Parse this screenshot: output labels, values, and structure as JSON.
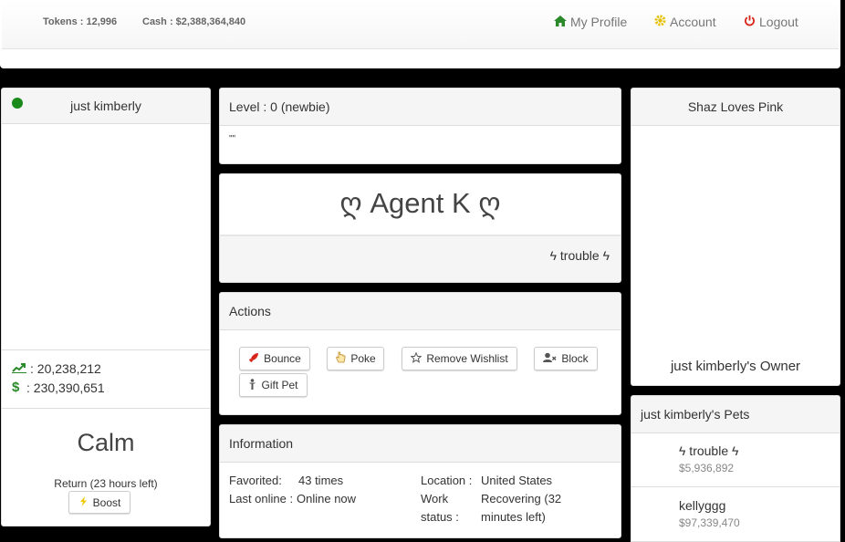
{
  "topbar": {
    "tokens": "Tokens : 12,996",
    "cash": "Cash : $2,388,364,840",
    "nav": {
      "profile": "My Profile",
      "account": "Account",
      "logout": "Logout"
    }
  },
  "left": {
    "name": "just kimberly",
    "stats": {
      "value_line": ": 20,238,212",
      "cash_line": ": 230,390,651"
    },
    "mood": "Calm",
    "return_text": "Return (23 hours left)",
    "boost_label": "Boost"
  },
  "center": {
    "level": "Level : 0 (newbie)",
    "quote": "\"\"",
    "title": "ღ Agent K ღ",
    "subtitle": "ϟ trouble ϟ",
    "actions": {
      "heading": "Actions",
      "bounce": "Bounce",
      "poke": "Poke",
      "remove_wishlist": "Remove Wishlist",
      "block": "Block",
      "gift_pet": "Gift Pet"
    },
    "info": {
      "heading": "Information",
      "favorited_label": "Favorited:",
      "favorited_value": "43 times",
      "last_online_label": "Last online :",
      "last_online_value": "Online now",
      "location_label": "Location :",
      "location_value": "United States",
      "work_label_1": "Work",
      "work_label_2": "status :",
      "work_value_1": "Recovering (32",
      "work_value_2": "minutes left)"
    }
  },
  "right": {
    "owner_heading": "Shaz Loves Pink",
    "owner_caption": "just kimberly's Owner",
    "pets_heading": "just kimberly's Pets",
    "pets": [
      {
        "name": "ϟ trouble ϟ",
        "value": "$5,936,892"
      },
      {
        "name": "kellyggg",
        "value": "$97,339,470"
      }
    ]
  },
  "colors": {
    "online_dot": "#1a8a1a",
    "green_icon": "#2a8a2a",
    "gear": "#e6c000",
    "logout": "#d9261c",
    "muted_value": "#888888"
  }
}
